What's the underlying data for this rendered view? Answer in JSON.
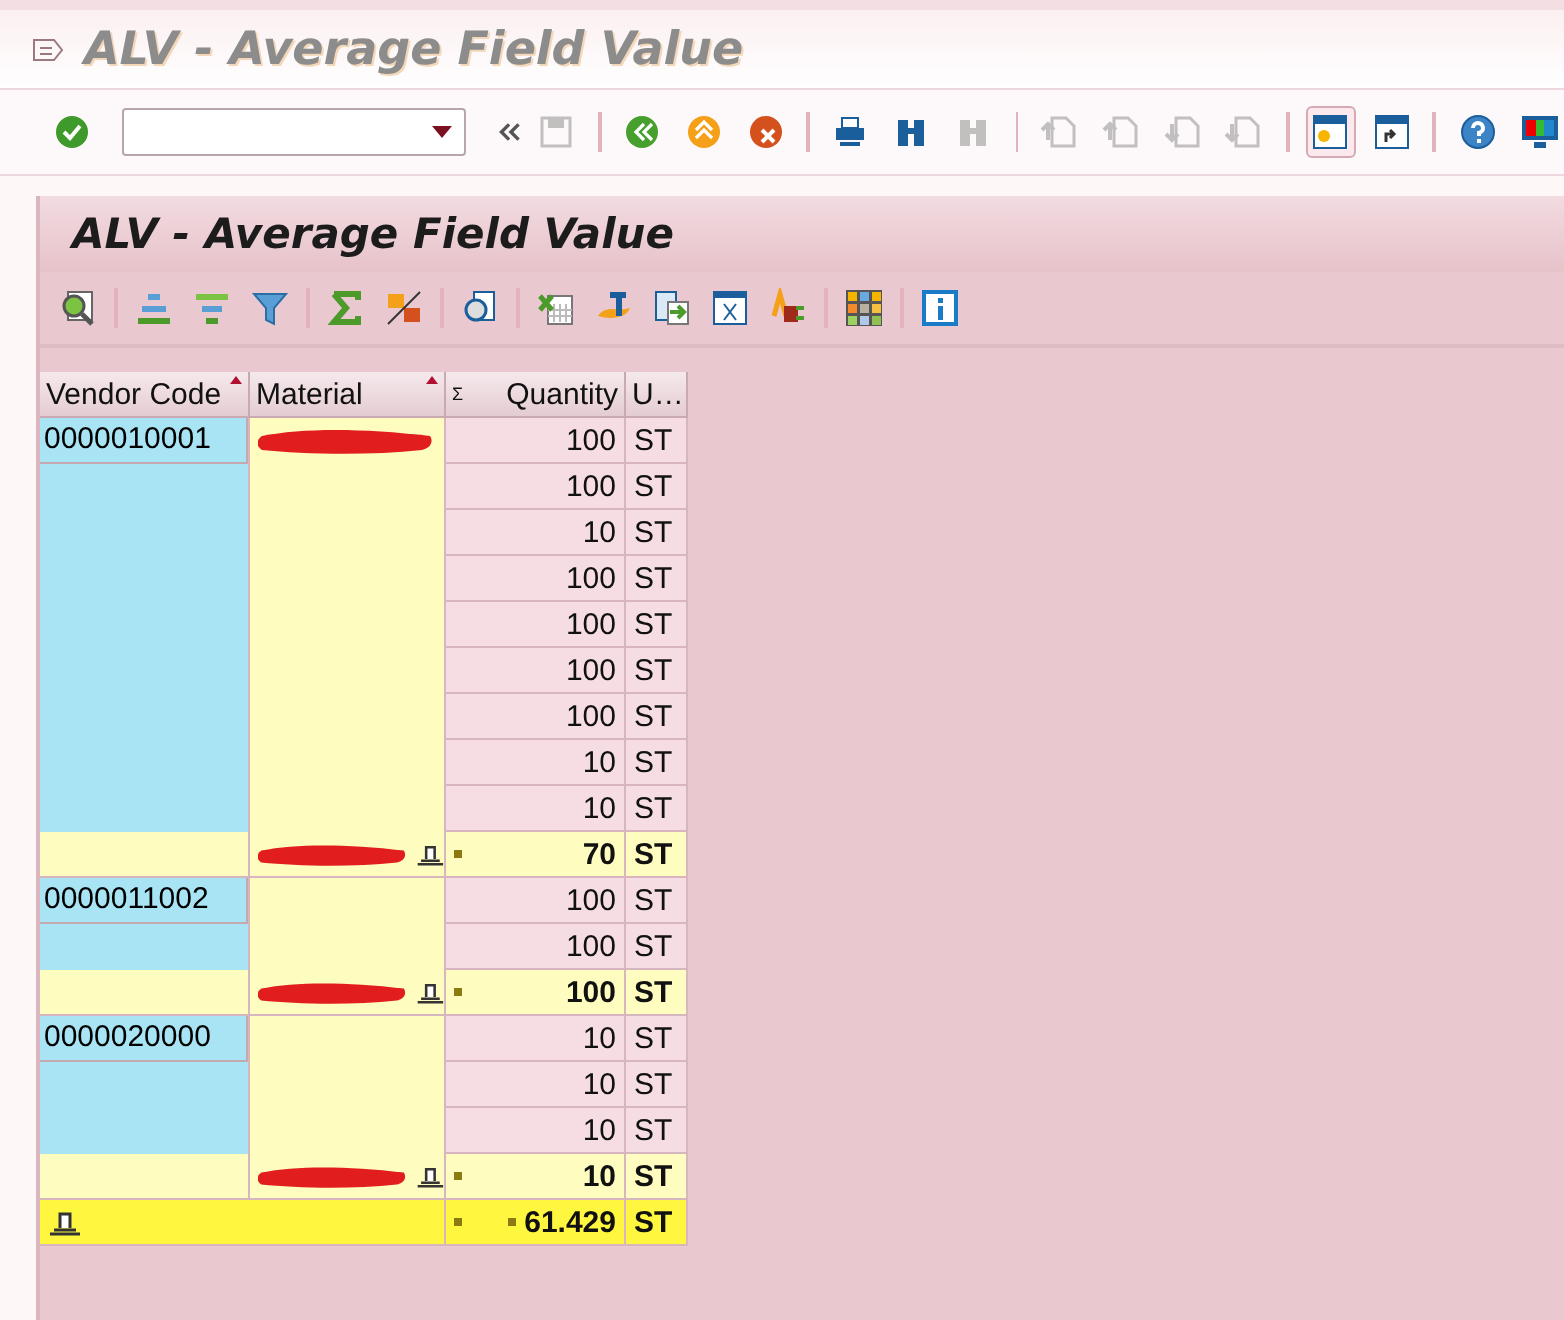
{
  "window": {
    "title": "ALV - Average Field Value"
  },
  "system_toolbar": [
    {
      "kind": "check",
      "disabled": false
    },
    {
      "kind": "command_field"
    },
    {
      "kind": "collapse"
    },
    {
      "kind": "save",
      "disabled": true
    },
    {
      "kind": "sep"
    },
    {
      "kind": "back",
      "disabled": false
    },
    {
      "kind": "exit",
      "disabled": false
    },
    {
      "kind": "cancel",
      "disabled": false
    },
    {
      "kind": "sep"
    },
    {
      "kind": "print",
      "disabled": false
    },
    {
      "kind": "find",
      "disabled": false
    },
    {
      "kind": "find_next",
      "disabled": true
    },
    {
      "kind": "sep"
    },
    {
      "kind": "first_page",
      "disabled": true
    },
    {
      "kind": "prev_page",
      "disabled": true
    },
    {
      "kind": "next_page",
      "disabled": true
    },
    {
      "kind": "last_page",
      "disabled": true
    },
    {
      "kind": "sep"
    },
    {
      "kind": "new_session",
      "disabled": false,
      "selected": true
    },
    {
      "kind": "shortcut",
      "disabled": false,
      "selected": false
    },
    {
      "kind": "sep"
    },
    {
      "kind": "help",
      "disabled": false
    },
    {
      "kind": "layout",
      "disabled": false
    }
  ],
  "panel": {
    "title": "ALV - Average Field Value"
  },
  "alv_toolbar": [
    {
      "kind": "details"
    },
    {
      "kind": "sep"
    },
    {
      "kind": "sort_asc"
    },
    {
      "kind": "sort_desc"
    },
    {
      "kind": "filter"
    },
    {
      "kind": "sep"
    },
    {
      "kind": "total"
    },
    {
      "kind": "subtotal"
    },
    {
      "kind": "sep"
    },
    {
      "kind": "print_preview"
    },
    {
      "kind": "sep"
    },
    {
      "kind": "excel"
    },
    {
      "kind": "word"
    },
    {
      "kind": "export"
    },
    {
      "kind": "abc"
    },
    {
      "kind": "graphic"
    },
    {
      "kind": "sep"
    },
    {
      "kind": "layout"
    },
    {
      "kind": "sep"
    },
    {
      "kind": "info"
    }
  ],
  "table": {
    "columns": [
      {
        "label": "Vendor Code",
        "sorted": true
      },
      {
        "label": "Material",
        "sorted": true
      },
      {
        "label": "Quantity",
        "sorted": false,
        "prefix": "Σ"
      },
      {
        "label": "U…",
        "sorted": false
      }
    ],
    "groups": [
      {
        "vendor": "0000010001",
        "rows": [
          {
            "quantity": "100",
            "unit": "ST"
          },
          {
            "quantity": "100",
            "unit": "ST"
          },
          {
            "quantity": "10",
            "unit": "ST"
          },
          {
            "quantity": "100",
            "unit": "ST"
          },
          {
            "quantity": "100",
            "unit": "ST"
          },
          {
            "quantity": "100",
            "unit": "ST"
          },
          {
            "quantity": "100",
            "unit": "ST"
          },
          {
            "quantity": "10",
            "unit": "ST"
          },
          {
            "quantity": "10",
            "unit": "ST"
          }
        ],
        "subtotal": {
          "quantity": "70",
          "unit": "ST"
        }
      },
      {
        "vendor": "0000011002",
        "rows": [
          {
            "quantity": "100",
            "unit": "ST"
          },
          {
            "quantity": "100",
            "unit": "ST"
          }
        ],
        "subtotal": {
          "quantity": "100",
          "unit": "ST"
        }
      },
      {
        "vendor": "0000020000",
        "rows": [
          {
            "quantity": "10",
            "unit": "ST"
          },
          {
            "quantity": "10",
            "unit": "ST"
          },
          {
            "quantity": "10",
            "unit": "ST"
          }
        ],
        "subtotal": {
          "quantity": "10",
          "unit": "ST"
        }
      }
    ],
    "total": {
      "quantity": "61.429",
      "unit": "ST"
    }
  }
}
